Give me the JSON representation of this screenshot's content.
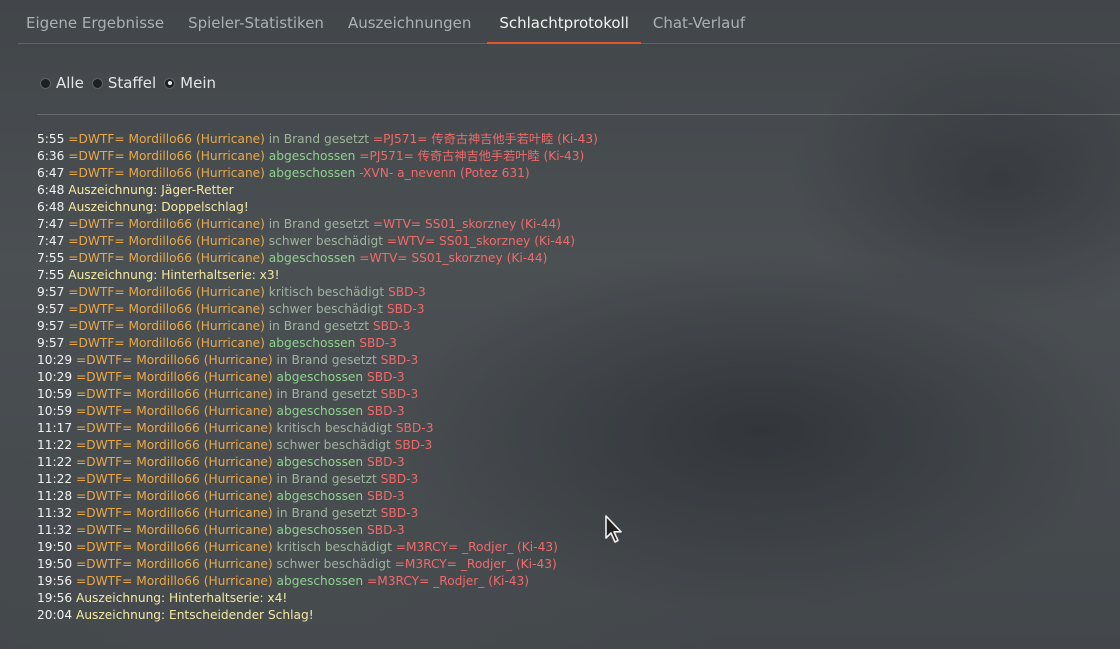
{
  "tabs": [
    {
      "label": "Eigene Ergebnisse"
    },
    {
      "label": "Spieler-Statistiken"
    },
    {
      "label": "Auszeichnungen"
    },
    {
      "label": "Schlachtprotokoll"
    },
    {
      "label": "Chat-Verlauf"
    }
  ],
  "filters": [
    {
      "label": "Alle"
    },
    {
      "label": "Staffel"
    },
    {
      "label": "Mein"
    }
  ],
  "colors": {
    "player": "#e8a84a",
    "enemy": "#ef6a6a",
    "action": "#9eb39e",
    "kill": "#8fd18f",
    "award": "#f3e9a3",
    "tab_active_underline": "#e0582a"
  },
  "log": [
    {
      "time": "5:55",
      "player": "=DWTF= Mordillo66 (Hurricane)",
      "action": "in Brand gesetzt",
      "target": "=PJ571= 传奇古神吉他手若叶睦 (Ki-43)"
    },
    {
      "time": "6:36",
      "player": "=DWTF= Mordillo66 (Hurricane)",
      "action": "abgeschossen",
      "target": "=PJ571= 传奇古神吉他手若叶睦 (Ki-43)"
    },
    {
      "time": "6:47",
      "player": "=DWTF= Mordillo66 (Hurricane)",
      "action": "abgeschossen",
      "target": "-XVN- a_nevenn (Potez 631)"
    },
    {
      "time": "6:48",
      "award": "Auszeichnung: Jäger-Retter"
    },
    {
      "time": "6:48",
      "award": "Auszeichnung: Doppelschlag!"
    },
    {
      "time": "7:47",
      "player": "=DWTF= Mordillo66 (Hurricane)",
      "action": "in Brand gesetzt",
      "target": "=WTV= SS01_skorzney (Ki-44)"
    },
    {
      "time": "7:47",
      "player": "=DWTF= Mordillo66 (Hurricane)",
      "action": "schwer beschädigt",
      "target": "=WTV= SS01_skorzney (Ki-44)"
    },
    {
      "time": "7:55",
      "player": "=DWTF= Mordillo66 (Hurricane)",
      "action": "abgeschossen",
      "target": "=WTV= SS01_skorzney (Ki-44)"
    },
    {
      "time": "7:55",
      "award": "Auszeichnung: Hinterhaltserie: x3!"
    },
    {
      "time": "9:57",
      "player": "=DWTF= Mordillo66 (Hurricane)",
      "action": "kritisch beschädigt",
      "target": "SBD-3"
    },
    {
      "time": "9:57",
      "player": "=DWTF= Mordillo66 (Hurricane)",
      "action": "schwer beschädigt",
      "target": "SBD-3"
    },
    {
      "time": "9:57",
      "player": "=DWTF= Mordillo66 (Hurricane)",
      "action": "in Brand gesetzt",
      "target": "SBD-3"
    },
    {
      "time": "9:57",
      "player": "=DWTF= Mordillo66 (Hurricane)",
      "action": "abgeschossen",
      "target": "SBD-3"
    },
    {
      "time": "10:29",
      "player": "=DWTF= Mordillo66 (Hurricane)",
      "action": "in Brand gesetzt",
      "target": "SBD-3"
    },
    {
      "time": "10:29",
      "player": "=DWTF= Mordillo66 (Hurricane)",
      "action": "abgeschossen",
      "target": "SBD-3"
    },
    {
      "time": "10:59",
      "player": "=DWTF= Mordillo66 (Hurricane)",
      "action": "in Brand gesetzt",
      "target": "SBD-3"
    },
    {
      "time": "10:59",
      "player": "=DWTF= Mordillo66 (Hurricane)",
      "action": "abgeschossen",
      "target": "SBD-3"
    },
    {
      "time": "11:17",
      "player": "=DWTF= Mordillo66 (Hurricane)",
      "action": "kritisch beschädigt",
      "target": "SBD-3"
    },
    {
      "time": "11:22",
      "player": "=DWTF= Mordillo66 (Hurricane)",
      "action": "schwer beschädigt",
      "target": "SBD-3"
    },
    {
      "time": "11:22",
      "player": "=DWTF= Mordillo66 (Hurricane)",
      "action": "abgeschossen",
      "target": "SBD-3"
    },
    {
      "time": "11:22",
      "player": "=DWTF= Mordillo66 (Hurricane)",
      "action": "in Brand gesetzt",
      "target": "SBD-3"
    },
    {
      "time": "11:28",
      "player": "=DWTF= Mordillo66 (Hurricane)",
      "action": "abgeschossen",
      "target": "SBD-3"
    },
    {
      "time": "11:32",
      "player": "=DWTF= Mordillo66 (Hurricane)",
      "action": "in Brand gesetzt",
      "target": "SBD-3"
    },
    {
      "time": "11:32",
      "player": "=DWTF= Mordillo66 (Hurricane)",
      "action": "abgeschossen",
      "target": "SBD-3"
    },
    {
      "time": "19:50",
      "player": "=DWTF= Mordillo66 (Hurricane)",
      "action": "kritisch beschädigt",
      "target": "=M3RCY= _Rodjer_ (Ki-43)"
    },
    {
      "time": "19:50",
      "player": "=DWTF= Mordillo66 (Hurricane)",
      "action": "schwer beschädigt",
      "target": "=M3RCY= _Rodjer_ (Ki-43)"
    },
    {
      "time": "19:56",
      "player": "=DWTF= Mordillo66 (Hurricane)",
      "action": "abgeschossen",
      "target": "=M3RCY= _Rodjer_ (Ki-43)"
    },
    {
      "time": "19:56",
      "award": "Auszeichnung: Hinterhaltserie: x4!"
    },
    {
      "time": "20:04",
      "award": "Auszeichnung: Entscheidender Schlag!"
    }
  ]
}
